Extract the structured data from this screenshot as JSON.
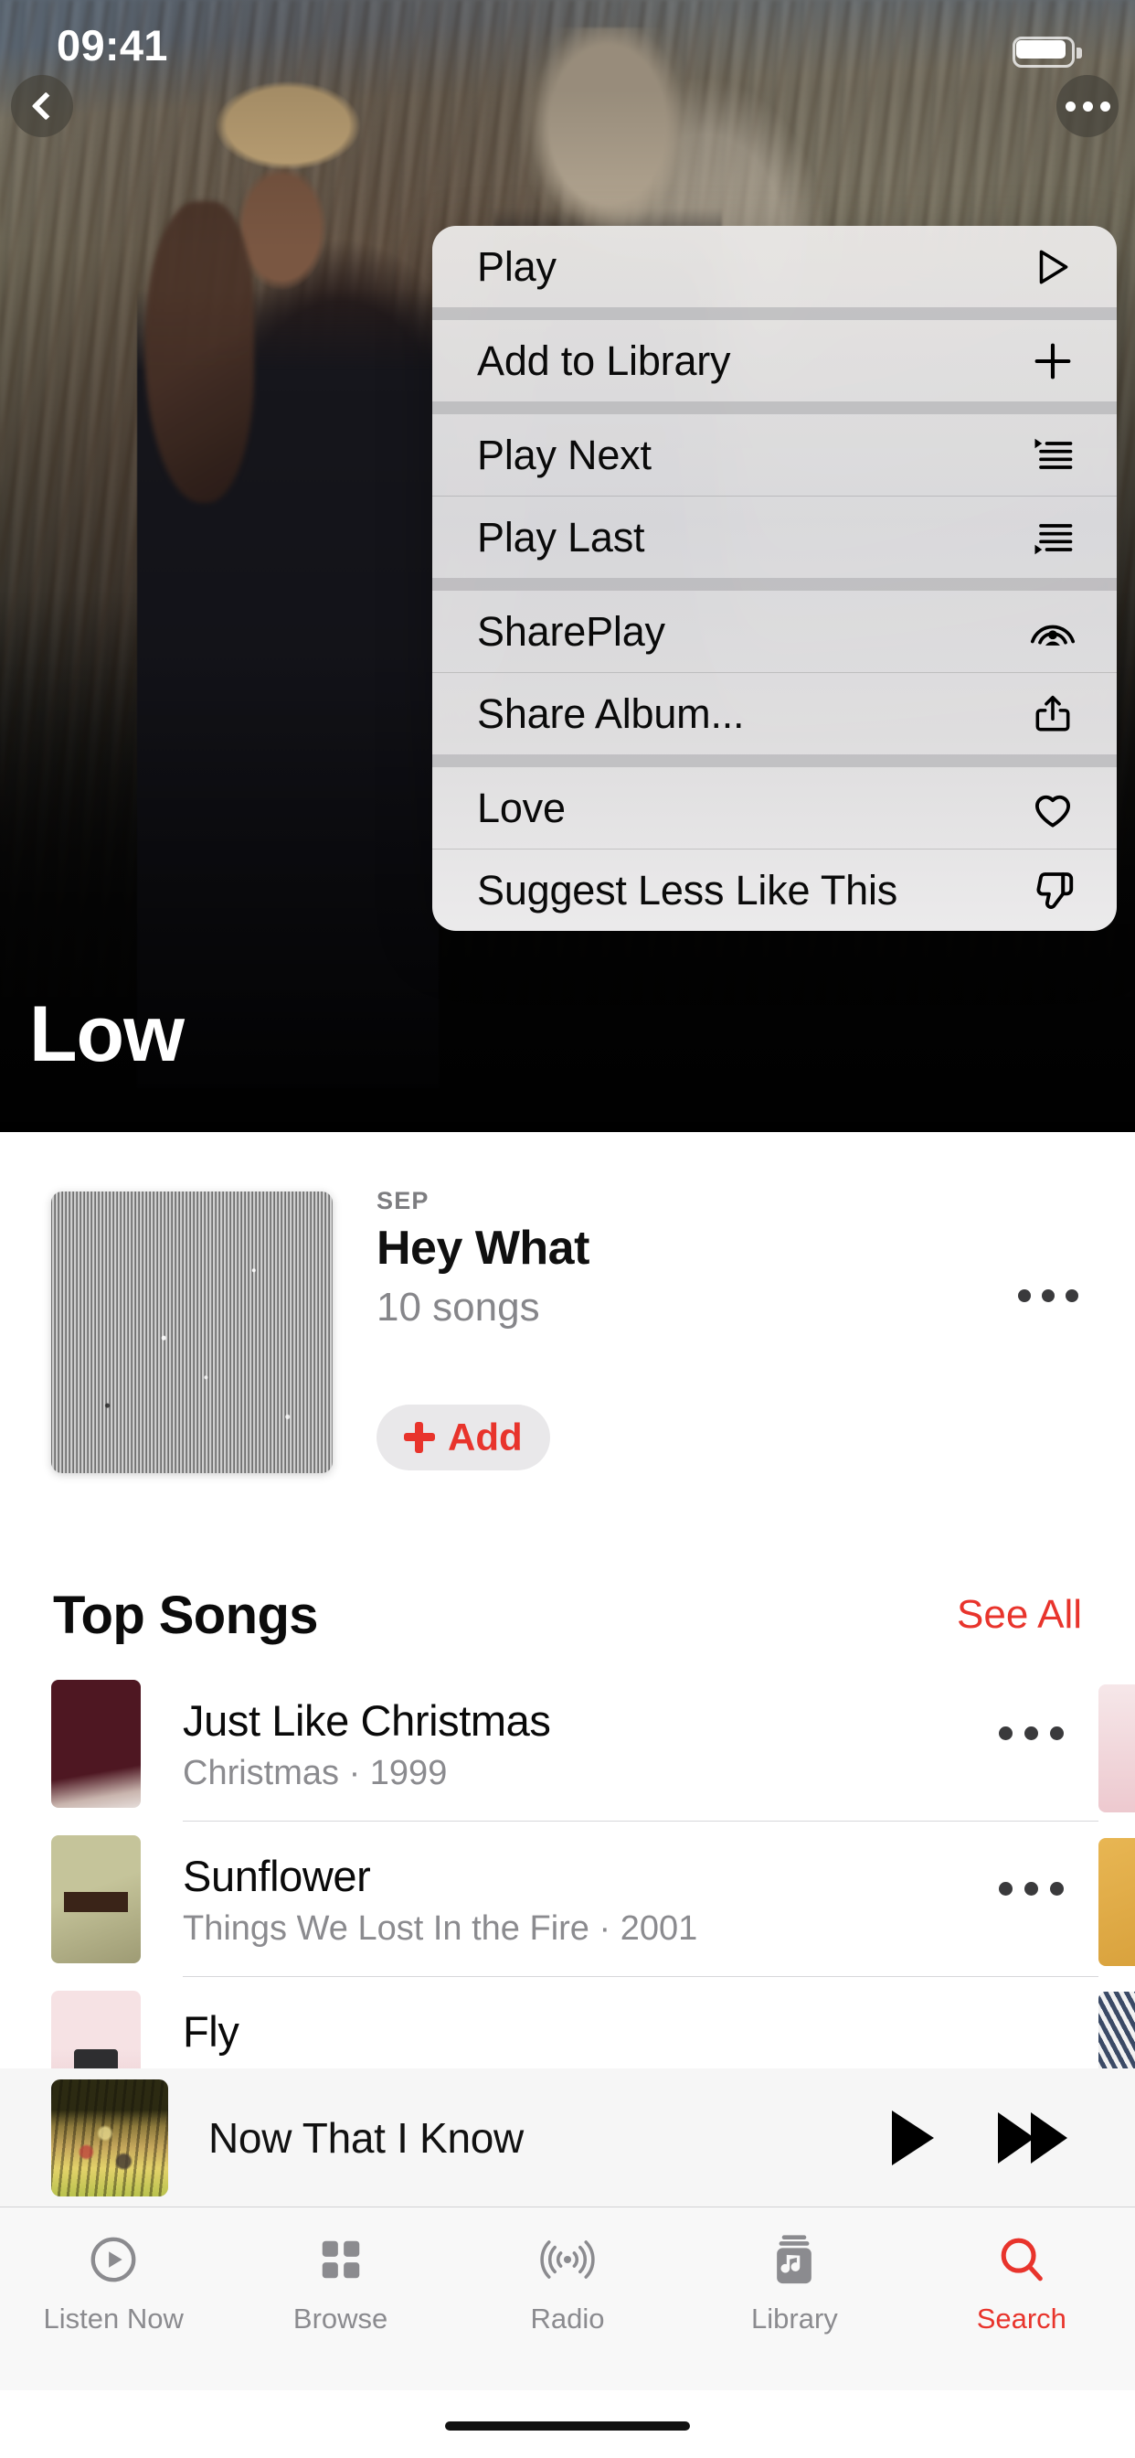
{
  "status_bar": {
    "time": "09:41",
    "battery_icon": "battery-full-icon"
  },
  "hero": {
    "title": "Low",
    "back_icon": "chevron-left-icon",
    "more_icon": "ellipsis-icon"
  },
  "context_menu": {
    "groups": [
      {
        "items": [
          {
            "label": "Play",
            "icon": "play-triangle-icon"
          }
        ]
      },
      {
        "items": [
          {
            "label": "Add to Library",
            "icon": "plus-icon"
          }
        ]
      },
      {
        "items": [
          {
            "label": "Play Next",
            "icon": "play-next-list-icon"
          },
          {
            "label": "Play Last",
            "icon": "play-last-list-icon"
          }
        ]
      },
      {
        "items": [
          {
            "label": "SharePlay",
            "icon": "shareplay-icon"
          },
          {
            "label": "Share Album...",
            "icon": "share-square-up-arrow-icon"
          }
        ]
      },
      {
        "items": [
          {
            "label": "Love",
            "icon": "heart-icon"
          },
          {
            "label": "Suggest Less Like This",
            "icon": "thumbs-down-icon"
          }
        ]
      }
    ]
  },
  "album": {
    "release_label": "SEP",
    "name": "Hey What",
    "song_count": "10 songs",
    "add_button": "Add",
    "add_icon": "plus-icon",
    "more_icon": "ellipsis-icon"
  },
  "top_songs": {
    "title": "Top Songs",
    "see_all": "See All",
    "rows": [
      {
        "title": "Just Like Christmas",
        "subtitle": "Christmas · 1999",
        "more_icon": "ellipsis-icon"
      },
      {
        "title": "Sunflower",
        "subtitle": "Things We Lost In the Fire · 2001",
        "more_icon": "ellipsis-icon"
      },
      {
        "title": "Fly",
        "subtitle": "",
        "more_icon": "ellipsis-icon"
      }
    ]
  },
  "now_playing": {
    "title": "Now That I Know",
    "play_icon": "play-icon",
    "forward_icon": "fast-forward-icon"
  },
  "tab_bar": {
    "tabs": [
      {
        "label": "Listen Now",
        "icon": "play-circle-icon",
        "active": false
      },
      {
        "label": "Browse",
        "icon": "grid-squares-icon",
        "active": false
      },
      {
        "label": "Radio",
        "icon": "radio-waves-icon",
        "active": false
      },
      {
        "label": "Library",
        "icon": "music-library-icon",
        "active": false
      },
      {
        "label": "Search",
        "icon": "magnifier-icon",
        "active": true
      }
    ]
  },
  "colors": {
    "accent": "#e8342c",
    "inactive": "#8b8b8f",
    "text": "#0a0a0a"
  }
}
